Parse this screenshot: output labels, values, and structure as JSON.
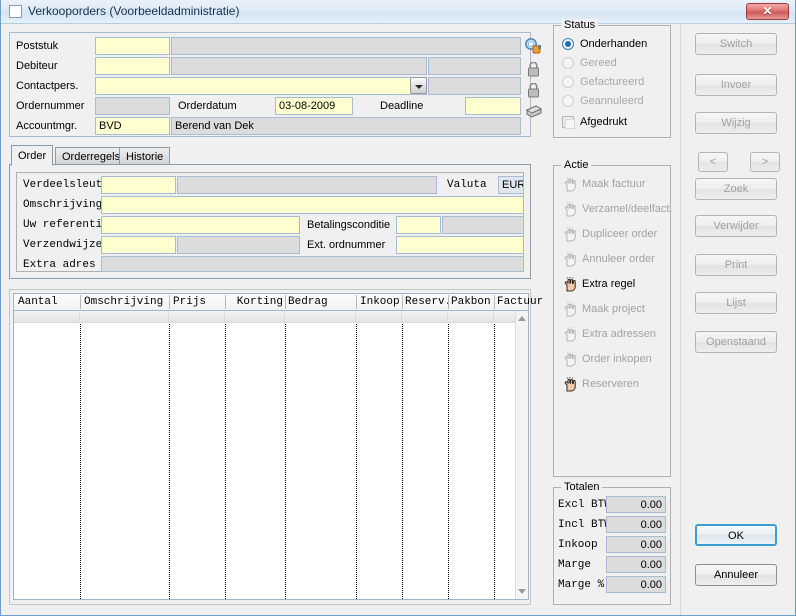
{
  "window": {
    "title": "Verkooporders (Voorbeeldadministratie)",
    "close_label": "✕",
    "icons": {
      "app": "window-icon",
      "close": "close-icon"
    }
  },
  "colors": {
    "titlebar": "#dfeaf6",
    "editable_field": "#ffffd0",
    "readonly_field": "#dcdcdc",
    "accent_default_button": "#3c9fd4",
    "close_button": "#cd5b57",
    "disabled_text": "#a2a2a2"
  },
  "top_form": {
    "rows": [
      {
        "label": "Poststuk",
        "code_value": "",
        "name_value": ""
      },
      {
        "label": "Debiteur",
        "code_value": "",
        "name_value": "",
        "extra_value": ""
      },
      {
        "label": "Contactpers.",
        "code_value": "",
        "name_value": ""
      },
      {
        "label": "Ordernummer",
        "code_value": ""
      },
      {
        "label": "Accountmgr.",
        "code_value": "BVD",
        "name_value": "Berend van Dek"
      }
    ],
    "orderdatum_label": "Orderdatum",
    "orderdatum_value": "03-08-2009",
    "deadline_label": "Deadline",
    "deadline_value": "",
    "side_icons": [
      {
        "name": "search-icon"
      },
      {
        "name": "lock-icon-1"
      },
      {
        "name": "lock-icon-2"
      },
      {
        "name": "print-stamp-icon"
      }
    ]
  },
  "tabs": [
    {
      "label": "Order",
      "active": true
    },
    {
      "label": "Orderregels",
      "active": false
    },
    {
      "label": "Historie",
      "active": false
    }
  ],
  "order_tab": {
    "verdeelsleutel_label": "Verdeelsleutel",
    "verdeelsleutel_value": "",
    "verdeelsleutel_desc": "",
    "valuta_label": "Valuta",
    "valuta_value": "EUR",
    "omschrijving_label": "Omschrijving",
    "omschrijving_value": "",
    "uw_referentie_label": "Uw referentie",
    "uw_referentie_value": "",
    "betalingsconditie_label": "Betalingsconditie",
    "betalingsconditie_value": "",
    "betalingsconditie_desc": "",
    "verzendwijze_label": "Verzendwijze",
    "verzendwijze_value": "",
    "verzendwijze_desc": "",
    "ext_ordnummer_label": "Ext. ordnummer",
    "ext_ordnummer_value": "",
    "extra_adres_label": "Extra adres",
    "extra_adres_value": ""
  },
  "grid": {
    "columns": [
      {
        "label": "Aantal",
        "align": "left"
      },
      {
        "label": "Omschrijving",
        "align": "left"
      },
      {
        "label": "Prijs",
        "align": "left"
      },
      {
        "label": "Korting",
        "align": "right"
      },
      {
        "label": "Bedrag",
        "align": "left"
      },
      {
        "label": "Inkoop",
        "align": "left"
      },
      {
        "label": "Reserv.",
        "align": "left"
      },
      {
        "label": "Pakbon",
        "align": "left"
      },
      {
        "label": "Factuur",
        "align": "left"
      }
    ],
    "rows": [],
    "row_count": 0
  },
  "status": {
    "legend": "Status",
    "options": [
      {
        "label": "Onderhanden",
        "selected": true,
        "enabled": true
      },
      {
        "label": "Gereed",
        "selected": false,
        "enabled": false
      },
      {
        "label": "Gefactureerd",
        "selected": false,
        "enabled": false
      },
      {
        "label": "Geannuleerd",
        "selected": false,
        "enabled": false
      }
    ],
    "checkbox": {
      "label": "Afgedrukt",
      "checked": false
    }
  },
  "actie": {
    "legend": "Actie",
    "items": [
      {
        "label": "Maak factuur",
        "enabled": false,
        "icon": "hand-click-icon"
      },
      {
        "label": "Verzamel/deelfact.",
        "enabled": false,
        "icon": "hand-click-icon"
      },
      {
        "label": "Dupliceer order",
        "enabled": false,
        "icon": "hand-click-icon"
      },
      {
        "label": "Annuleer order",
        "enabled": false,
        "icon": "hand-click-icon"
      },
      {
        "label": "Extra regel",
        "enabled": true,
        "icon": "hand-click-icon"
      },
      {
        "label": "Maak project",
        "enabled": false,
        "icon": "hand-click-icon"
      },
      {
        "label": "Extra adressen",
        "enabled": false,
        "icon": "hand-click-icon"
      },
      {
        "label": "Order inkopen",
        "enabled": false,
        "icon": "hand-click-icon"
      },
      {
        "label": "Reserveren",
        "enabled": false,
        "icon": "hand-click-icon",
        "icon_active": true
      }
    ]
  },
  "totalen": {
    "legend": "Totalen",
    "rows": [
      {
        "label": "Excl BTW",
        "value": "0.00"
      },
      {
        "label": "Incl BTW",
        "value": "0.00"
      },
      {
        "label": "Inkoop",
        "value": "0.00"
      },
      {
        "label": "Marge",
        "value": "0.00"
      },
      {
        "label": "Marge %",
        "value": "0.00"
      }
    ]
  },
  "side_buttons": {
    "switch": {
      "label": "Switch",
      "enabled": false
    },
    "invoer": {
      "label": "Invoer",
      "enabled": false
    },
    "wijzig": {
      "label": "Wijzig",
      "enabled": false
    },
    "prev": {
      "label": "<",
      "enabled": false
    },
    "next": {
      "label": ">",
      "enabled": false
    },
    "zoek": {
      "label": "Zoek",
      "enabled": false
    },
    "verwijder": {
      "label": "Verwijder",
      "enabled": false
    },
    "print": {
      "label": "Print",
      "enabled": false
    },
    "lijst": {
      "label": "Lijst",
      "enabled": false
    },
    "openstaand": {
      "label": "Openstaand",
      "enabled": false
    },
    "ok": {
      "label": "OK",
      "enabled": true,
      "default": true
    },
    "annuleer": {
      "label": "Annuleer",
      "enabled": true
    }
  }
}
